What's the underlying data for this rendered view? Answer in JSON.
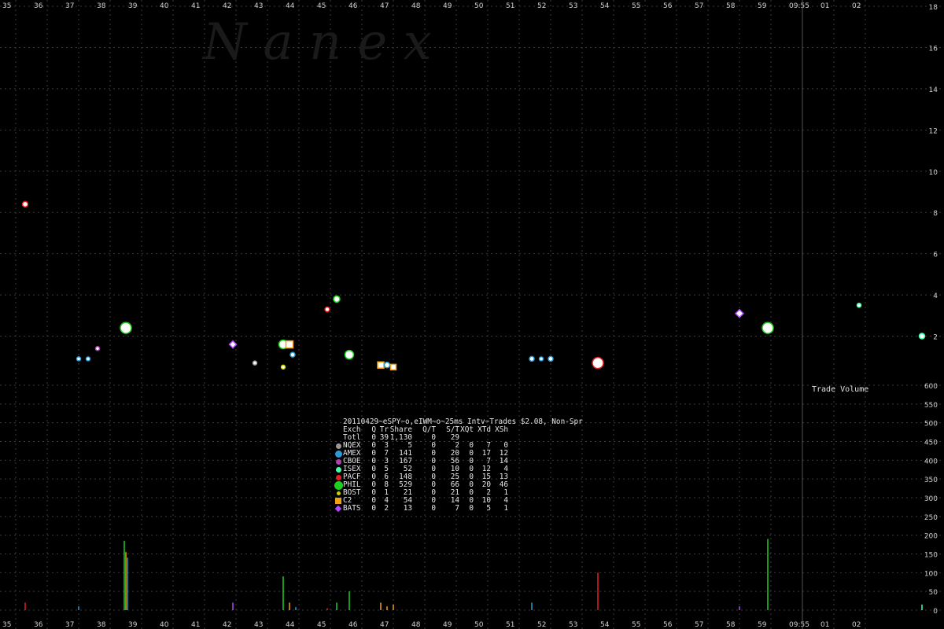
{
  "chart_data": {
    "type": "scatter",
    "title": "20110429~eSPY~o,eIWM~o~25ms Intv~Trades $2.08, Non-Spr",
    "watermark": "N a n e x",
    "x": {
      "ticks": [
        "35",
        "36",
        "37",
        "38",
        "39",
        "40",
        "41",
        "42",
        "43",
        "44",
        "45",
        "46",
        "47",
        "48",
        "49",
        "50",
        "51",
        "52",
        "53",
        "54",
        "55",
        "56",
        "57",
        "58",
        "59",
        "09:55",
        "01",
        "02"
      ],
      "range": [
        35,
        64
      ]
    },
    "upper_panel": {
      "ylim": [
        0,
        18
      ],
      "yticks": [
        "18",
        "16",
        "14",
        "12",
        "10",
        "8",
        "6",
        "4",
        "2"
      ],
      "points": [
        {
          "x": 35.3,
          "y": 8.4,
          "exch": "PACF",
          "size": 5
        },
        {
          "x": 37.0,
          "y": 0.9,
          "exch": "AMEX",
          "size": 3
        },
        {
          "x": 37.3,
          "y": 0.9,
          "exch": "AMEX",
          "size": 3
        },
        {
          "x": 37.6,
          "y": 1.4,
          "exch": "CBOE",
          "size": 3
        },
        {
          "x": 38.5,
          "y": 2.4,
          "exch": "PHIL",
          "size": 12
        },
        {
          "x": 41.9,
          "y": 1.6,
          "exch": "BATS",
          "size": 5
        },
        {
          "x": 42.6,
          "y": 0.7,
          "exch": "NQEX",
          "size": 3
        },
        {
          "x": 43.5,
          "y": 1.6,
          "exch": "PHIL",
          "size": 9
        },
        {
          "x": 43.7,
          "y": 1.6,
          "exch": "C2",
          "size": 7
        },
        {
          "x": 43.5,
          "y": 0.5,
          "exch": "BOST",
          "size": 3
        },
        {
          "x": 43.8,
          "y": 1.1,
          "exch": "AMEX",
          "size": 4
        },
        {
          "x": 44.9,
          "y": 3.3,
          "exch": "PACF",
          "size": 4
        },
        {
          "x": 45.2,
          "y": 3.8,
          "exch": "PHIL",
          "size": 6
        },
        {
          "x": 45.6,
          "y": 1.1,
          "exch": "PHIL",
          "size": 9
        },
        {
          "x": 46.6,
          "y": 0.6,
          "exch": "C2",
          "size": 6
        },
        {
          "x": 46.8,
          "y": 0.6,
          "exch": "AMEX",
          "size": 5
        },
        {
          "x": 47.0,
          "y": 0.5,
          "exch": "C2",
          "size": 5
        },
        {
          "x": 51.4,
          "y": 0.9,
          "exch": "AMEX",
          "size": 4
        },
        {
          "x": 51.7,
          "y": 0.9,
          "exch": "AMEX",
          "size": 3
        },
        {
          "x": 52.0,
          "y": 0.9,
          "exch": "AMEX",
          "size": 4
        },
        {
          "x": 53.5,
          "y": 0.7,
          "exch": "PACF",
          "size": 12
        },
        {
          "x": 58.0,
          "y": 3.1,
          "exch": "BATS",
          "size": 6
        },
        {
          "x": 58.9,
          "y": 2.4,
          "exch": "PHIL",
          "size": 12
        },
        {
          "x": 61.8,
          "y": 3.5,
          "exch": "ISEX",
          "size": 3
        },
        {
          "x": 63.8,
          "y": 2.0,
          "exch": "ISEX",
          "size": 5
        }
      ]
    },
    "lower_panel": {
      "label": "Trade Volume",
      "ylim": [
        0,
        600
      ],
      "yticks": [
        "600",
        "550",
        "500",
        "450",
        "400",
        "350",
        "300",
        "250",
        "200",
        "150",
        "100",
        "50",
        "0"
      ],
      "bars": [
        {
          "x": 35.3,
          "value": 20,
          "exch": "PACF"
        },
        {
          "x": 37.0,
          "value": 10,
          "exch": "AMEX"
        },
        {
          "x": 38.45,
          "value": 185,
          "exch": "PHIL"
        },
        {
          "x": 38.5,
          "value": 155,
          "exch": "C2"
        },
        {
          "x": 38.55,
          "value": 140,
          "exch": "AMEX"
        },
        {
          "x": 41.9,
          "value": 20,
          "exch": "BATS"
        },
        {
          "x": 43.5,
          "value": 90,
          "exch": "PHIL"
        },
        {
          "x": 43.7,
          "value": 20,
          "exch": "C2"
        },
        {
          "x": 43.9,
          "value": 8,
          "exch": "AMEX"
        },
        {
          "x": 44.9,
          "value": 5,
          "exch": "PACF"
        },
        {
          "x": 45.2,
          "value": 20,
          "exch": "PHIL"
        },
        {
          "x": 45.6,
          "value": 50,
          "exch": "PHIL"
        },
        {
          "x": 46.6,
          "value": 20,
          "exch": "C2"
        },
        {
          "x": 46.8,
          "value": 10,
          "exch": "C2"
        },
        {
          "x": 47.0,
          "value": 15,
          "exch": "C2"
        },
        {
          "x": 51.4,
          "value": 20,
          "exch": "AMEX"
        },
        {
          "x": 53.5,
          "value": 100,
          "exch": "PACF"
        },
        {
          "x": 58.0,
          "value": 10,
          "exch": "BATS"
        },
        {
          "x": 58.9,
          "value": 190,
          "exch": "PHIL"
        },
        {
          "x": 63.8,
          "value": 15,
          "exch": "ISEX"
        }
      ]
    },
    "cursor_x": 60.0,
    "colors": {
      "NQEX": "#999999",
      "AMEX": "#2a9bd8",
      "CBOE": "#b23fb0",
      "ISEX": "#40ffaa",
      "PACF": "#e81e1e",
      "PHIL": "#1ed01e",
      "BOST": "#c8d200",
      "C2": "#f0a010",
      "BATS": "#b048ff"
    }
  },
  "legend": {
    "title": "20110429~eSPY~o,eIWM~o~25ms Intv~Trades $2.08, Non-Spr",
    "header": [
      "Exch",
      "Q",
      "Tr",
      "Share",
      "Q/T",
      "S/T",
      "XQt",
      "XTd",
      "XSh"
    ],
    "total": [
      "Totl",
      "0",
      "39",
      "1,130",
      "0",
      "29",
      "",
      "",
      ""
    ],
    "rows": [
      {
        "swatch": "circle",
        "color": "#999999",
        "cells": [
          "NQEX",
          "0",
          "3",
          "5",
          "0",
          "2",
          "0",
          "7",
          "0"
        ]
      },
      {
        "swatch": "circle-lg",
        "color": "#2a9bd8",
        "cells": [
          "AMEX",
          "0",
          "7",
          "141",
          "0",
          "20",
          "0",
          "17",
          "12"
        ]
      },
      {
        "swatch": "circle",
        "color": "#b23fb0",
        "cells": [
          "CBOE",
          "0",
          "3",
          "167",
          "0",
          "56",
          "0",
          "7",
          "14"
        ]
      },
      {
        "swatch": "circle",
        "color": "#40ffaa",
        "cells": [
          "ISEX",
          "0",
          "5",
          "52",
          "0",
          "10",
          "0",
          "12",
          "4"
        ]
      },
      {
        "swatch": "circle",
        "color": "#e81e1e",
        "cells": [
          "PACF",
          "0",
          "6",
          "148",
          "0",
          "25",
          "0",
          "15",
          "13"
        ]
      },
      {
        "swatch": "circle-xl",
        "color": "#1ed01e",
        "cells": [
          "PHIL",
          "0",
          "8",
          "529",
          "0",
          "66",
          "0",
          "20",
          "46"
        ]
      },
      {
        "swatch": "circle-sm",
        "color": "#c8d200",
        "cells": [
          "BOST",
          "0",
          "1",
          "21",
          "0",
          "21",
          "0",
          "2",
          "1"
        ]
      },
      {
        "swatch": "square",
        "color": "#f0a010",
        "cells": [
          "C2",
          "0",
          "4",
          "54",
          "0",
          "14",
          "0",
          "10",
          "4"
        ]
      },
      {
        "swatch": "diamond",
        "color": "#b048ff",
        "cells": [
          "BATS",
          "0",
          "2",
          "13",
          "0",
          "7",
          "0",
          "5",
          "1"
        ]
      }
    ]
  }
}
